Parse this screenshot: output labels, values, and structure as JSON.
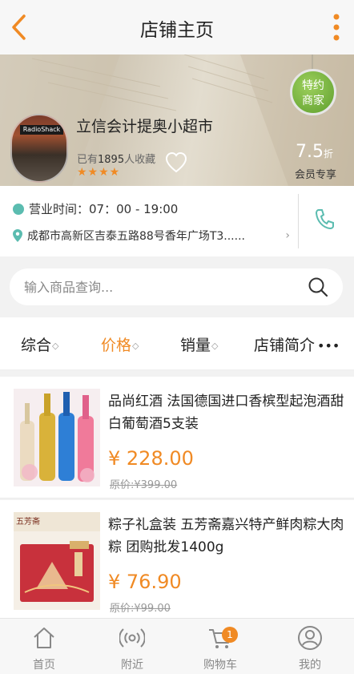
{
  "header": {
    "title": "店铺主页"
  },
  "store": {
    "name": "立信会计提奥小超市",
    "fav_prefix": "已有",
    "fav_count": "1895",
    "fav_suffix": "人收藏",
    "stars": "★★★★",
    "rating": 4,
    "badge_line1": "特约",
    "badge_line2": "商家",
    "discount_value": "7.5",
    "discount_unit": "折",
    "member_label": "会员专享",
    "sign_text": "RadioShack"
  },
  "info": {
    "hours": "营业时间：07：00 - 19:00",
    "address": "成都市高新区吉泰五路88号香年广场T3......"
  },
  "search": {
    "placeholder": "输入商品查询..."
  },
  "sort": [
    {
      "label": "综合"
    },
    {
      "label": "价格"
    },
    {
      "label": "销量"
    },
    {
      "label": "店铺简介"
    }
  ],
  "products": [
    {
      "name": "品尚红酒 法国德国进口香槟型起泡酒甜白葡萄酒5支装",
      "price": "¥ 228.00",
      "original": "原价:¥399.00"
    },
    {
      "name": "粽子礼盒装 五芳斋嘉兴特产鲜肉粽大肉粽 团购批发1400g",
      "price": "¥ 76.90",
      "original": "原价:¥99.00",
      "box_text": "五芳斋"
    }
  ],
  "tabbar": {
    "home": "首页",
    "nearby": "附近",
    "cart": "购物车",
    "mine": "我的",
    "cart_count": "1"
  },
  "colors": {
    "accent": "#f08a24",
    "teal": "#5bbcb0",
    "badge_green": "#6aa83a"
  }
}
